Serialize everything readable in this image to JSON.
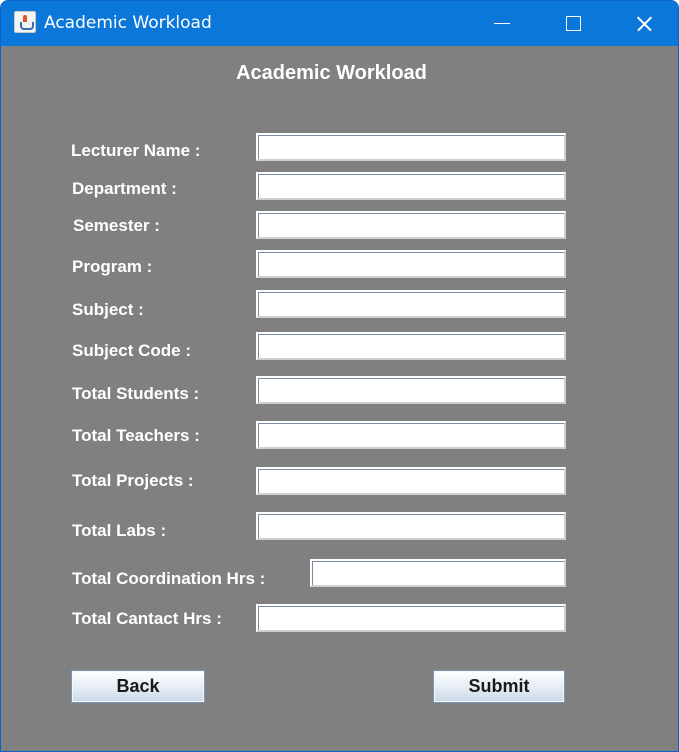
{
  "window": {
    "title": "Academic Workload",
    "controls": {
      "minimize": "minimize",
      "maximize": "maximize",
      "close": "close"
    }
  },
  "form": {
    "heading": "Academic Workload",
    "fields": [
      {
        "label": "Lecturer Name :",
        "value": ""
      },
      {
        "label": "Department :",
        "value": ""
      },
      {
        "label": "Semester :",
        "value": ""
      },
      {
        "label": "Program :",
        "value": ""
      },
      {
        "label": "Subject :",
        "value": ""
      },
      {
        "label": "Subject Code :",
        "value": ""
      },
      {
        "label": "Total Students :",
        "value": ""
      },
      {
        "label": "Total Teachers :",
        "value": ""
      },
      {
        "label": "Total Projects :",
        "value": ""
      },
      {
        "label": "Total Labs :",
        "value": ""
      },
      {
        "label": "Total Coordination Hrs :",
        "value": ""
      },
      {
        "label": "Total Cantact Hrs :",
        "value": ""
      }
    ]
  },
  "buttons": {
    "back": "Back",
    "submit": "Submit"
  },
  "colors": {
    "titlebar": "#0b77d8",
    "background": "#808080",
    "text": "#ffffff"
  }
}
